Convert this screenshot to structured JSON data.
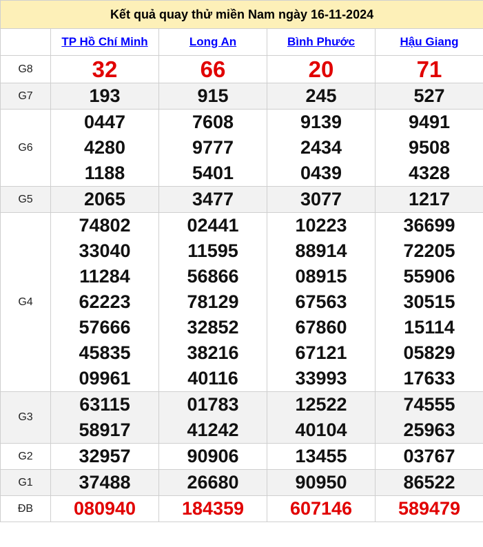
{
  "title": "Kết quả quay thử miền Nam ngày 16-11-2024",
  "provinces": [
    "TP Hồ Chí Minh",
    "Long An",
    "Bình Phước",
    "Hậu Giang"
  ],
  "prizes": [
    {
      "label": "G8",
      "values": [
        [
          "32"
        ],
        [
          "66"
        ],
        [
          "20"
        ],
        [
          "71"
        ]
      ]
    },
    {
      "label": "G7",
      "values": [
        [
          "193"
        ],
        [
          "915"
        ],
        [
          "245"
        ],
        [
          "527"
        ]
      ]
    },
    {
      "label": "G6",
      "values": [
        [
          "0447",
          "4280",
          "1188"
        ],
        [
          "7608",
          "9777",
          "5401"
        ],
        [
          "9139",
          "2434",
          "0439"
        ],
        [
          "9491",
          "9508",
          "4328"
        ]
      ]
    },
    {
      "label": "G5",
      "values": [
        [
          "2065"
        ],
        [
          "3477"
        ],
        [
          "3077"
        ],
        [
          "1217"
        ]
      ]
    },
    {
      "label": "G4",
      "values": [
        [
          "74802",
          "33040",
          "11284",
          "62223",
          "57666",
          "45835",
          "09961"
        ],
        [
          "02441",
          "11595",
          "56866",
          "78129",
          "32852",
          "38216",
          "40116"
        ],
        [
          "10223",
          "88914",
          "08915",
          "67563",
          "67860",
          "67121",
          "33993"
        ],
        [
          "36699",
          "72205",
          "55906",
          "30515",
          "15114",
          "05829",
          "17633"
        ]
      ]
    },
    {
      "label": "G3",
      "values": [
        [
          "63115",
          "58917"
        ],
        [
          "01783",
          "41242"
        ],
        [
          "12522",
          "40104"
        ],
        [
          "74555",
          "25963"
        ]
      ]
    },
    {
      "label": "G2",
      "values": [
        [
          "32957"
        ],
        [
          "90906"
        ],
        [
          "13455"
        ],
        [
          "03767"
        ]
      ]
    },
    {
      "label": "G1",
      "values": [
        [
          "37488"
        ],
        [
          "26680"
        ],
        [
          "90950"
        ],
        [
          "86522"
        ]
      ]
    },
    {
      "label": "ĐB",
      "values": [
        [
          "080940"
        ],
        [
          "184359"
        ],
        [
          "607146"
        ],
        [
          "589479"
        ]
      ]
    }
  ]
}
